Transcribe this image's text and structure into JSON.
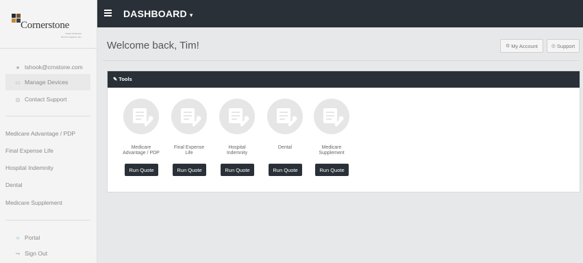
{
  "brand": {
    "name": "Cornerstone",
    "tagline_lines": [
      "Senior Insurance",
      "Services Agency, Inc."
    ],
    "square_colors": [
      "#2b2b2b",
      "#7a5230",
      "#c08a3e",
      "#3e3e3e"
    ]
  },
  "sidebar": {
    "account_items": [
      {
        "label": "tshook@crnstone.com",
        "icon": "user-icon"
      },
      {
        "label": "Manage Devices",
        "icon": "device-icon"
      },
      {
        "label": "Contact Support",
        "icon": "support-icon"
      }
    ],
    "product_items": [
      {
        "label": "Medicare Advantage / PDP"
      },
      {
        "label": "Final Expense Life"
      },
      {
        "label": "Hospital Indemnity"
      },
      {
        "label": "Dental"
      },
      {
        "label": "Medicare Supplement"
      }
    ],
    "bottom_items": [
      {
        "label": "Portal",
        "icon": "portal-icon"
      },
      {
        "label": "Sign Out",
        "icon": "sign-out-icon"
      }
    ]
  },
  "topbar": {
    "title": "DASHBOARD",
    "caret": "▾"
  },
  "header": {
    "welcome": "Welcome back, Tim!",
    "my_account": "My Account",
    "support": "Support"
  },
  "tools": {
    "title": "Tools",
    "items": [
      {
        "label": "Medicare\nAdvantage / PDP",
        "button": "Run Quote"
      },
      {
        "label": "Final Expense\nLife",
        "button": "Run Quote"
      },
      {
        "label": "Hospital\nIndemnity",
        "button": "Run Quote"
      },
      {
        "label": "Dental",
        "button": "Run Quote"
      },
      {
        "label": "Medicare\nSupplement",
        "button": "Run Quote"
      }
    ]
  },
  "colors": {
    "dark": "#2a3037",
    "background": "#e7e8ea"
  }
}
